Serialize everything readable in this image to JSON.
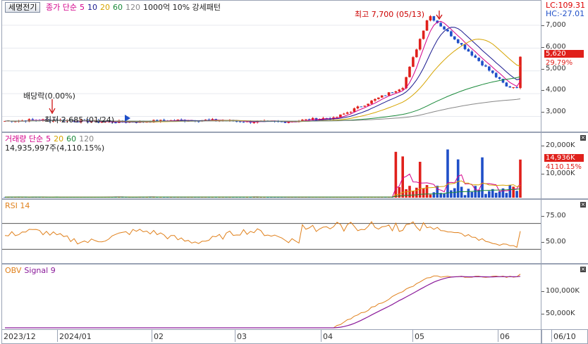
{
  "stock_name": "세명전기",
  "price_header": {
    "indicator": "종가 단순",
    "ma": [
      "5",
      "10",
      "20",
      "60",
      "120"
    ],
    "ma_colors": [
      "#d4008a",
      "#1a1a8f",
      "#d6a400",
      "#1a8a3a",
      "#888888"
    ],
    "extra": "1000억 10% 강세패턴"
  },
  "lc_label": "LC:109.31",
  "hc_label": "HC:-27.01",
  "high_annotation": "최고 7,700 (05/13)",
  "low_annotation": "최저 2,685 (01/24)",
  "dividend_annotation": "배당락(0.00%)",
  "price_axis": [
    "7,000",
    "6,000",
    "5,000",
    "4,000",
    "3,000"
  ],
  "price_current": "5,620",
  "price_change": "29.79%",
  "volume_header": {
    "indicator": "거래량 단순",
    "ma": [
      "5",
      "20",
      "60",
      "120"
    ],
    "ma_colors": [
      "#d4008a",
      "#d6a400",
      "#1a8a3a",
      "#888888"
    ],
    "info": "14,935,997주(4,110.15%)"
  },
  "volume_axis": [
    "20,000K",
    "10,000K"
  ],
  "volume_current": "14,936K",
  "volume_change": "4110.15%",
  "rsi_header": "RSI 14",
  "rsi_axis": [
    "75.00",
    "50.00"
  ],
  "obv_header": {
    "name": "OBV",
    "signal": "Signal 9"
  },
  "obv_axis": [
    "100,000K",
    "50,000K"
  ],
  "x_axis": [
    "2023/12",
    "2024/01",
    "02",
    "03",
    "04",
    "05",
    "06"
  ],
  "x_corner": "06/10",
  "colors": {
    "up": "#e0201b",
    "down": "#1f4fc8",
    "rsi": "#e0801b",
    "obv": "#e0801b",
    "signal": "#8a1a9a"
  }
}
